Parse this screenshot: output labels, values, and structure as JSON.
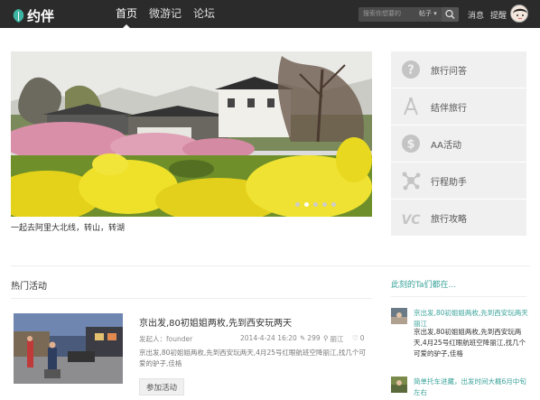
{
  "header": {
    "logo_text": "约伴",
    "nav": [
      {
        "label": "首页",
        "active": true
      },
      {
        "label": "微游记",
        "active": false
      },
      {
        "label": "论坛",
        "active": false
      }
    ],
    "search": {
      "placeholder": "搜索你想要的",
      "type_label": "帖子 ▾"
    },
    "messages_label": "消息",
    "remind_label": "提醒"
  },
  "hero": {
    "caption": "一起去阿里大北线，转山，转湖",
    "slides_count": 5,
    "active_slide": 2
  },
  "side_menu": [
    {
      "label": "旅行问答",
      "icon": "question-icon"
    },
    {
      "label": "结伴旅行",
      "icon": "compass-icon"
    },
    {
      "label": "AA活动",
      "icon": "dollar-icon"
    },
    {
      "label": "行程助手",
      "icon": "network-icon"
    },
    {
      "label": "旅行攻略",
      "icon": "vc-icon"
    }
  ],
  "hot": {
    "title": "热门活动",
    "activity": {
      "title": "京出发,80初姐姐两枚,先到西安玩两天",
      "author_prefix": "发起人：",
      "author": "founder",
      "date": "2014-4-24 16:20",
      "likes": "299",
      "location": "丽江",
      "comments": "0",
      "desc": "京出发,80初姐姐两枚,先到西安玩两天,4月25号红眼航班空降丽江,找几个可爱的驴子,佳格",
      "join_label": "参加活动"
    }
  },
  "right_feed": {
    "title": "此刻的Ta们都在...",
    "items": [
      {
        "title": "京出发,80初姐姐两枚,先到西安玩两天 丽江"
      },
      {
        "title": "京出发,80初姐姐两枚,先到西安玩两天,4月25号红眼航班空降丽江,找几个可爱的驴子,佳格"
      },
      {
        "title": "简单托车进藏，出发时间大概6月中旬左右"
      }
    ]
  },
  "colors": {
    "accent": "#3aa39a",
    "topbar": "#2b2b2b"
  }
}
